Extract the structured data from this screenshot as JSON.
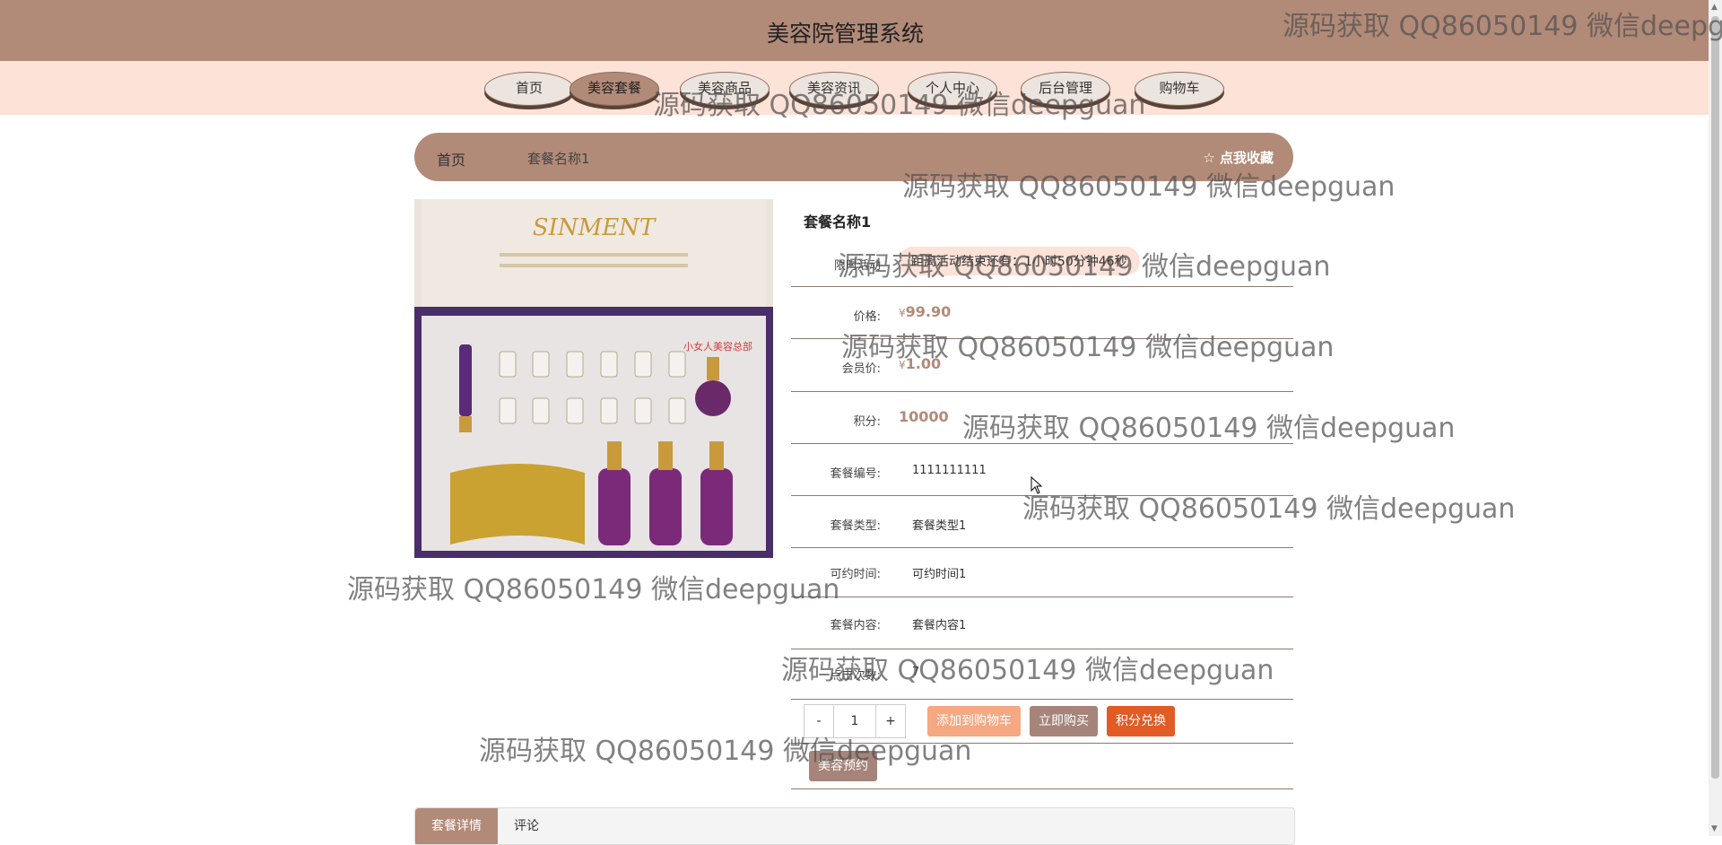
{
  "app": {
    "title": "美容院管理系统"
  },
  "nav": {
    "items": [
      {
        "label": "首页"
      },
      {
        "label": "美容套餐"
      },
      {
        "label": "美容商品"
      },
      {
        "label": "美容资讯"
      },
      {
        "label": "个人中心"
      },
      {
        "label": "后台管理"
      },
      {
        "label": "购物车"
      }
    ],
    "active_index": 1
  },
  "breadcrumb": {
    "home": "首页",
    "current": "套餐名称1",
    "favorite_label": "☆ 点我收藏"
  },
  "product": {
    "name": "套餐名称1",
    "fields": [
      {
        "label": "限时活动",
        "value": "距离活动结束还有：1小时50分钟46秒"
      },
      {
        "label": "价格:",
        "currency": "¥",
        "value": "99.90"
      },
      {
        "label": "会员价:",
        "currency": "¥",
        "value": "1.00"
      },
      {
        "label": "积分:",
        "value": "10000"
      },
      {
        "label": "套餐编号:",
        "value": "1111111111"
      },
      {
        "label": "套餐类型:",
        "value": "套餐类型1"
      },
      {
        "label": "可约时间:",
        "value": "可约时间1"
      },
      {
        "label": "套餐内容:",
        "value": "套餐内容1"
      },
      {
        "label": "点击次数:",
        "value": "7"
      }
    ],
    "quantity": {
      "minus": "-",
      "value": "1",
      "plus": "+"
    },
    "buttons": {
      "add_to_cart": "添加到购物车",
      "buy_now": "立即购买",
      "points_redeem": "积分兑换",
      "reserve": "美容预约"
    }
  },
  "image": {
    "brand_text": "SINMENT",
    "stamp_text": "小女人美容总部"
  },
  "tabs": [
    {
      "label": "套餐详情"
    },
    {
      "label": "评论"
    }
  ],
  "watermark": {
    "text": "源码获取 QQ86050149 微信deepguan"
  },
  "colors": {
    "header": "#b28a78",
    "navbar": "#fde2d8",
    "price": "#b28a78",
    "cart_button": "#f5a882",
    "buy_button": "#a6847a",
    "points_button": "#e25b25"
  }
}
